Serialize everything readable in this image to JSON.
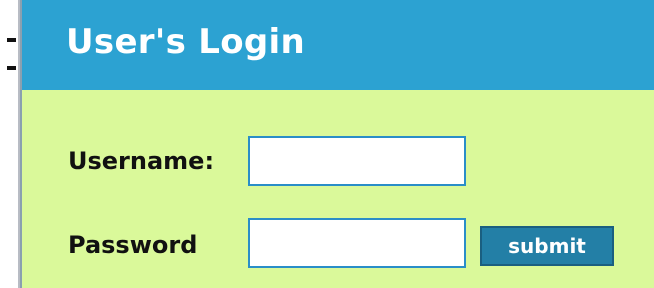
{
  "login": {
    "title": "User's Login",
    "username_label": "Username:",
    "username_value": "",
    "password_label": "Password",
    "password_value": "",
    "submit_label": "submit"
  },
  "colors": {
    "header_bg": "#2ca2d2",
    "panel_bg": "#daf99a",
    "button_bg": "#237fa6",
    "input_border": "#2a8ec8"
  }
}
